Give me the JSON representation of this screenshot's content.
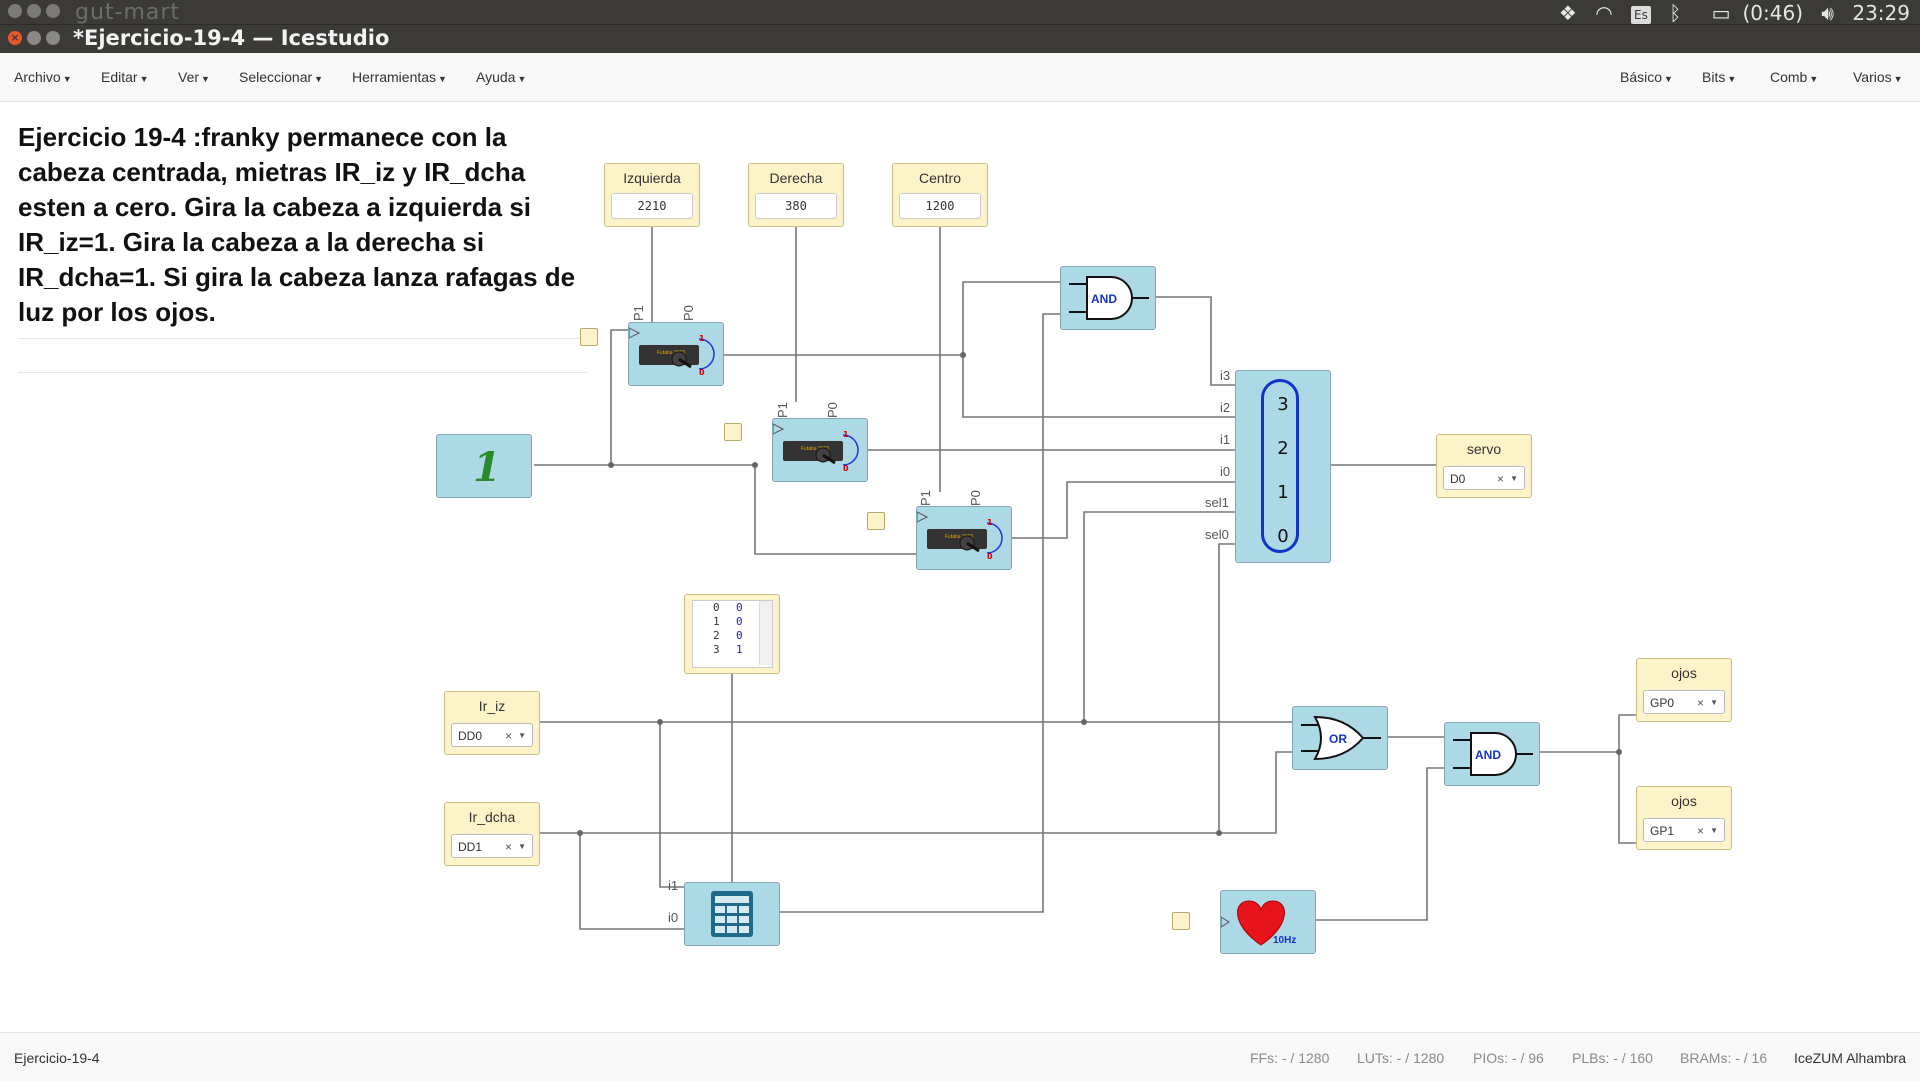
{
  "system_bar": {
    "app_name": "gut-mart",
    "keyboard": "Es",
    "battery": "(0:46)",
    "clock": "23:29"
  },
  "window": {
    "title": "*Ejercicio-19-4 — Icestudio"
  },
  "menu": {
    "left": [
      "Archivo",
      "Editar",
      "Ver",
      "Seleccionar",
      "Herramientas",
      "Ayuda"
    ],
    "right": [
      "Básico",
      "Bits",
      "Comb",
      "Varios"
    ]
  },
  "canvas": {
    "description": "Ejercicio 19-4 :franky permanece con la cabeza centrada, mietras IR_iz y IR_dcha esten a cero. Gira la cabeza a izquierda si IR_iz=1. Gira la cabeza a la derecha si IR_dcha=1. Si gira la cabeza lanza rafagas de luz por los ojos.",
    "constants": [
      {
        "label": "Izquierda",
        "value": "2210"
      },
      {
        "label": "Derecha",
        "value": "380"
      },
      {
        "label": "Centro",
        "value": "1200"
      }
    ],
    "servo_params": {
      "p1": "P1",
      "p0": "P0"
    },
    "servo_text": "Futaba 3003",
    "and_label": "AND",
    "or_label": "OR",
    "mux": {
      "inputs": [
        "i3",
        "i2",
        "i1",
        "i0",
        "sel1",
        "sel0"
      ],
      "numbers": [
        "3",
        "2",
        "1",
        "0"
      ]
    },
    "const_one": "1",
    "table": {
      "rows": [
        [
          "0",
          "0"
        ],
        [
          "1",
          "0"
        ],
        [
          "2",
          "0"
        ],
        [
          "3",
          "1"
        ]
      ]
    },
    "table_inputs": [
      "i1",
      "i0"
    ],
    "heart_freq": "10Hz",
    "inputs": [
      {
        "label": "Ir_iz",
        "pin": "DD0"
      },
      {
        "label": "Ir_dcha",
        "pin": "DD1"
      }
    ],
    "outputs": [
      {
        "label": "servo",
        "pin": "D0"
      },
      {
        "label": "ojos",
        "pin": "GP0"
      },
      {
        "label": "ojos",
        "pin": "GP1"
      }
    ],
    "select_clear": "×"
  },
  "status": {
    "project": "Ejercicio-19-4",
    "ffs": "FFs:  - / 1280",
    "luts": "LUTs:  - / 1280",
    "pios": "PIOs:  - / 96",
    "plbs": "PLBs:  - / 160",
    "brams": "BRAMs:  - / 16",
    "board": "IceZUM Alhambra"
  },
  "colors": {
    "block_blue": "#add8e6",
    "block_yellow": "#fdf3c8",
    "wire": "#777777",
    "titlebar": "#3b3a36",
    "close_button": "#e9582d"
  }
}
